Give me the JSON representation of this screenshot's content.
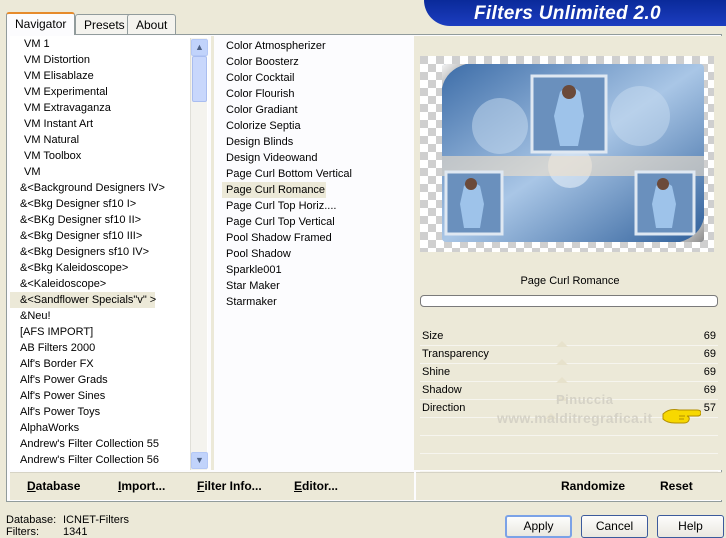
{
  "tabs": [
    "Navigator",
    "Presets",
    "About"
  ],
  "banner_title": "Filters Unlimited 2.0",
  "categories": [
    {
      "label": "VM 1",
      "cls": "vm"
    },
    {
      "label": "VM Distortion",
      "cls": "vm"
    },
    {
      "label": "VM Elisablaze",
      "cls": "vm"
    },
    {
      "label": "VM Experimental",
      "cls": "vm"
    },
    {
      "label": "VM Extravaganza",
      "cls": "vm"
    },
    {
      "label": "VM Instant Art",
      "cls": "vm"
    },
    {
      "label": "VM Natural",
      "cls": "vm"
    },
    {
      "label": "VM Toolbox",
      "cls": "vm"
    },
    {
      "label": "VM",
      "cls": "vm"
    },
    {
      "label": "&<Background Designers IV>",
      "cls": ""
    },
    {
      "label": "&<Bkg Designer sf10 I>",
      "cls": ""
    },
    {
      "label": "&<BKg Designer sf10 II>",
      "cls": ""
    },
    {
      "label": "&<Bkg Designer sf10 III>",
      "cls": ""
    },
    {
      "label": "&<Bkg Designers sf10 IV>",
      "cls": ""
    },
    {
      "label": "&<Bkg Kaleidoscope>",
      "cls": ""
    },
    {
      "label": "&<Kaleidoscope>",
      "cls": ""
    },
    {
      "label": "&<Sandflower Specials\"v\" >",
      "cls": "sel"
    },
    {
      "label": "&Neu!",
      "cls": ""
    },
    {
      "label": "[AFS IMPORT]",
      "cls": ""
    },
    {
      "label": "AB Filters 2000",
      "cls": ""
    },
    {
      "label": "Alf's Border FX",
      "cls": ""
    },
    {
      "label": "Alf's Power Grads",
      "cls": ""
    },
    {
      "label": "Alf's Power Sines",
      "cls": ""
    },
    {
      "label": "Alf's Power Toys",
      "cls": ""
    },
    {
      "label": "AlphaWorks",
      "cls": ""
    },
    {
      "label": "Andrew's Filter Collection 55",
      "cls": ""
    },
    {
      "label": "Andrew's Filter Collection 56",
      "cls": ""
    }
  ],
  "filters": [
    {
      "label": "Color Atmospherizer",
      "cls": ""
    },
    {
      "label": "Color Boosterz",
      "cls": ""
    },
    {
      "label": "Color Cocktail",
      "cls": ""
    },
    {
      "label": "Color Flourish",
      "cls": ""
    },
    {
      "label": "Color Gradiant",
      "cls": ""
    },
    {
      "label": "Colorize Septia",
      "cls": ""
    },
    {
      "label": "Design Blinds",
      "cls": ""
    },
    {
      "label": "Design Videowand",
      "cls": ""
    },
    {
      "label": "Page Curl Bottom Vertical",
      "cls": ""
    },
    {
      "label": "Page Curl Romance",
      "cls": "sel"
    },
    {
      "label": "Page Curl Top Horiz....",
      "cls": ""
    },
    {
      "label": "Page Curl Top Vertical",
      "cls": ""
    },
    {
      "label": "Pool Shadow Framed",
      "cls": ""
    },
    {
      "label": "Pool Shadow",
      "cls": ""
    },
    {
      "label": "Sparkle001",
      "cls": ""
    },
    {
      "label": "Star Maker",
      "cls": ""
    },
    {
      "label": "Starmaker",
      "cls": ""
    }
  ],
  "selected_filter": "Page Curl Romance",
  "progress": 0,
  "params": [
    {
      "name": "Size",
      "value": "69",
      "level": 0.27
    },
    {
      "name": "Transparency",
      "value": "69",
      "level": 0.27
    },
    {
      "name": "Shine",
      "value": "69",
      "level": 0.27
    },
    {
      "name": "Shadow",
      "value": "69",
      "level": 0.27
    },
    {
      "name": "Direction",
      "value": "57",
      "level": 0.22
    }
  ],
  "watermark_line1": "Pinuccia",
  "watermark_line2": "www.malditregrafica.it",
  "bottom": {
    "database": "Database",
    "import": "Import...",
    "filter_info": "Filter Info...",
    "editor": "Editor...",
    "randomize": "Randomize",
    "reset": "Reset"
  },
  "status": {
    "database_label": "Database:",
    "database_value": "ICNET-Filters",
    "filters_label": "Filters:",
    "filters_value": "1341"
  },
  "buttons": {
    "apply": "Apply",
    "cancel": "Cancel",
    "help": "Help"
  }
}
